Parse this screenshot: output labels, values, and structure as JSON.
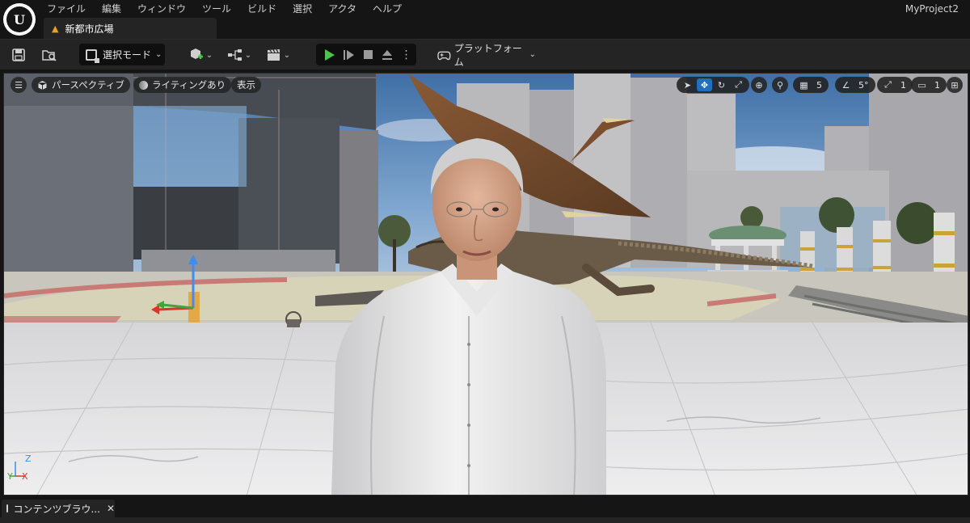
{
  "app": {
    "project_name": "MyProject2",
    "logo_letter": "U"
  },
  "menu": [
    "ファイル",
    "編集",
    "ウィンドウ",
    "ツール",
    "ビルド",
    "選択",
    "アクタ",
    "ヘルプ"
  ],
  "level_tab": {
    "label": "新都市広場"
  },
  "toolbar": {
    "mode_select_label": "選択モード",
    "platform_label": "プラットフォーム"
  },
  "viewport": {
    "perspective_label": "パースペクティブ",
    "lighting_label": "ライティングあり",
    "show_label": "表示",
    "grid_snap_value": "5",
    "rotation_snap_value": "5°",
    "scale_snap_value": "1",
    "camera_speed_value": "1",
    "axis_z": "Z",
    "axis_x": "X",
    "axis_y": "Y"
  },
  "bottom": {
    "content_browser_tab": "コンテンツブラウ..."
  },
  "icons": {
    "save": "save-icon",
    "browse": "folder-search-icon",
    "add_actor": "add-cube-icon",
    "blueprint": "blueprint-icon",
    "cinematics": "clapperboard-icon",
    "platform": "gamepad-icon",
    "hamburger": "hamburger-icon",
    "perspective": "cube-icon"
  },
  "colors": {
    "accent_blue": "#1f6ebf",
    "play_green": "#4ec24a",
    "warning_orange": "#f0a020"
  }
}
